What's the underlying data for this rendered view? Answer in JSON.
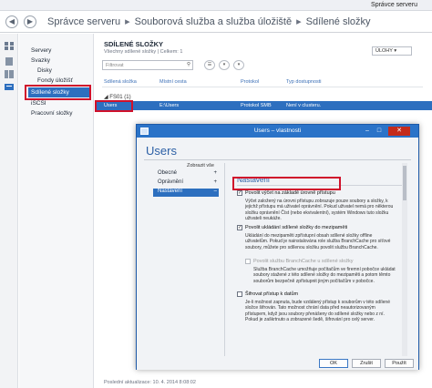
{
  "window": {
    "title": "Správce serveru"
  },
  "breadcrumb": {
    "parts": [
      "Správce serveru",
      "Souborová služba a služba úložiště",
      "Sdílené složky"
    ]
  },
  "nav": {
    "items": [
      "Servery",
      "Svazky",
      "Disky",
      "Fondy úložišť",
      "Sdílené složky",
      "iSCSI",
      "Pracovní složky"
    ]
  },
  "shares": {
    "title": "SDÍLENÉ SLOŽKY",
    "subtitle": "Všechny sdílené složky | Celkem: 1",
    "tasks_label": "ÚLOHY",
    "filter_placeholder": "Filtrovat",
    "columns": [
      "Sdílená složka",
      "Místní cesta",
      "Protokol",
      "Typ dostupnosti"
    ],
    "group": "FS01 (1)",
    "row": {
      "name": "Users",
      "path": "E:\\Users",
      "protocol": "Protokol SMB",
      "availability": "Není v clusteru."
    },
    "status": "Poslední aktualizace: 10. 4. 2014 8:08:02"
  },
  "dialog": {
    "title": "Users – vlastnosti",
    "heading": "Users",
    "show_all": "Zobrazit vše",
    "nav": [
      {
        "label": "Obecné",
        "sign": "+"
      },
      {
        "label": "Oprávnění",
        "sign": "+"
      },
      {
        "label": "Nastavení",
        "sign": "–"
      }
    ],
    "section_title": "Nastavení",
    "opt1": {
      "label": "Povolit výčet na základě úrovně přístupu",
      "checked": "✓",
      "desc": "Výčet založený na úrovni přístupu zobrazuje pouze soubory a složky, k jejichž přístupu má uživatel oprávnění. Pokud uživatel nemá pro některou složku oprávnění Číst (nebo ekvivalentní), systém Windows tuto složku uživateli neukáže."
    },
    "opt2": {
      "label": "Povolit ukládání sdílené složky do mezipaměti",
      "checked": "✓",
      "desc": "Ukládání do mezipaměti zpřístupní obsah sdílené složky offline uživatelům. Pokud je nainstalována role služba BranchCache pro síťové soubory, můžete pro sdílenou složku povolit službu BranchCache."
    },
    "opt3": {
      "label": "Povolit službu BranchCache u sdílené složky",
      "desc": "Služba BranchCache umožňuje počítačům ve firemní pobočce ukládat soubory stažené z této sdílené složky do mezipaměti a potom těmto souborům bezpečně zpřístupnit jiným počítačům v pobočce."
    },
    "opt4": {
      "label": "Šifrovat přístup k datům",
      "desc": "Je-li možnost zapnuta, bude vzdálený přístup k souborům v této sdílené složce šifrován. Tato možnost chrání data před neautorizovaným přístupem, když jsou soubory přenášeny do sdílené složky nebo z ní. Pokud je zaškrtnuto a zobrazené šedě, šifrování pro celý server."
    },
    "buttons": [
      "OK",
      "Zrušit",
      "Použít"
    ]
  }
}
